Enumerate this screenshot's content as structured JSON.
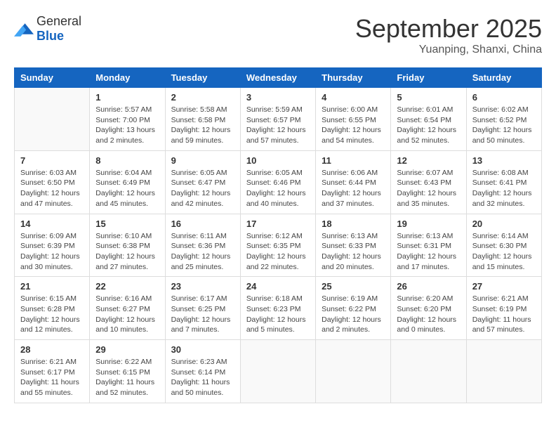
{
  "header": {
    "logo_general": "General",
    "logo_blue": "Blue",
    "month_title": "September 2025",
    "location": "Yuanping, Shanxi, China"
  },
  "weekdays": [
    "Sunday",
    "Monday",
    "Tuesday",
    "Wednesday",
    "Thursday",
    "Friday",
    "Saturday"
  ],
  "weeks": [
    [
      {
        "day": "",
        "sunrise": "",
        "sunset": "",
        "daylight": ""
      },
      {
        "day": "1",
        "sunrise": "Sunrise: 5:57 AM",
        "sunset": "Sunset: 7:00 PM",
        "daylight": "Daylight: 13 hours and 2 minutes."
      },
      {
        "day": "2",
        "sunrise": "Sunrise: 5:58 AM",
        "sunset": "Sunset: 6:58 PM",
        "daylight": "Daylight: 12 hours and 59 minutes."
      },
      {
        "day": "3",
        "sunrise": "Sunrise: 5:59 AM",
        "sunset": "Sunset: 6:57 PM",
        "daylight": "Daylight: 12 hours and 57 minutes."
      },
      {
        "day": "4",
        "sunrise": "Sunrise: 6:00 AM",
        "sunset": "Sunset: 6:55 PM",
        "daylight": "Daylight: 12 hours and 54 minutes."
      },
      {
        "day": "5",
        "sunrise": "Sunrise: 6:01 AM",
        "sunset": "Sunset: 6:54 PM",
        "daylight": "Daylight: 12 hours and 52 minutes."
      },
      {
        "day": "6",
        "sunrise": "Sunrise: 6:02 AM",
        "sunset": "Sunset: 6:52 PM",
        "daylight": "Daylight: 12 hours and 50 minutes."
      }
    ],
    [
      {
        "day": "7",
        "sunrise": "Sunrise: 6:03 AM",
        "sunset": "Sunset: 6:50 PM",
        "daylight": "Daylight: 12 hours and 47 minutes."
      },
      {
        "day": "8",
        "sunrise": "Sunrise: 6:04 AM",
        "sunset": "Sunset: 6:49 PM",
        "daylight": "Daylight: 12 hours and 45 minutes."
      },
      {
        "day": "9",
        "sunrise": "Sunrise: 6:05 AM",
        "sunset": "Sunset: 6:47 PM",
        "daylight": "Daylight: 12 hours and 42 minutes."
      },
      {
        "day": "10",
        "sunrise": "Sunrise: 6:05 AM",
        "sunset": "Sunset: 6:46 PM",
        "daylight": "Daylight: 12 hours and 40 minutes."
      },
      {
        "day": "11",
        "sunrise": "Sunrise: 6:06 AM",
        "sunset": "Sunset: 6:44 PM",
        "daylight": "Daylight: 12 hours and 37 minutes."
      },
      {
        "day": "12",
        "sunrise": "Sunrise: 6:07 AM",
        "sunset": "Sunset: 6:43 PM",
        "daylight": "Daylight: 12 hours and 35 minutes."
      },
      {
        "day": "13",
        "sunrise": "Sunrise: 6:08 AM",
        "sunset": "Sunset: 6:41 PM",
        "daylight": "Daylight: 12 hours and 32 minutes."
      }
    ],
    [
      {
        "day": "14",
        "sunrise": "Sunrise: 6:09 AM",
        "sunset": "Sunset: 6:39 PM",
        "daylight": "Daylight: 12 hours and 30 minutes."
      },
      {
        "day": "15",
        "sunrise": "Sunrise: 6:10 AM",
        "sunset": "Sunset: 6:38 PM",
        "daylight": "Daylight: 12 hours and 27 minutes."
      },
      {
        "day": "16",
        "sunrise": "Sunrise: 6:11 AM",
        "sunset": "Sunset: 6:36 PM",
        "daylight": "Daylight: 12 hours and 25 minutes."
      },
      {
        "day": "17",
        "sunrise": "Sunrise: 6:12 AM",
        "sunset": "Sunset: 6:35 PM",
        "daylight": "Daylight: 12 hours and 22 minutes."
      },
      {
        "day": "18",
        "sunrise": "Sunrise: 6:13 AM",
        "sunset": "Sunset: 6:33 PM",
        "daylight": "Daylight: 12 hours and 20 minutes."
      },
      {
        "day": "19",
        "sunrise": "Sunrise: 6:13 AM",
        "sunset": "Sunset: 6:31 PM",
        "daylight": "Daylight: 12 hours and 17 minutes."
      },
      {
        "day": "20",
        "sunrise": "Sunrise: 6:14 AM",
        "sunset": "Sunset: 6:30 PM",
        "daylight": "Daylight: 12 hours and 15 minutes."
      }
    ],
    [
      {
        "day": "21",
        "sunrise": "Sunrise: 6:15 AM",
        "sunset": "Sunset: 6:28 PM",
        "daylight": "Daylight: 12 hours and 12 minutes."
      },
      {
        "day": "22",
        "sunrise": "Sunrise: 6:16 AM",
        "sunset": "Sunset: 6:27 PM",
        "daylight": "Daylight: 12 hours and 10 minutes."
      },
      {
        "day": "23",
        "sunrise": "Sunrise: 6:17 AM",
        "sunset": "Sunset: 6:25 PM",
        "daylight": "Daylight: 12 hours and 7 minutes."
      },
      {
        "day": "24",
        "sunrise": "Sunrise: 6:18 AM",
        "sunset": "Sunset: 6:23 PM",
        "daylight": "Daylight: 12 hours and 5 minutes."
      },
      {
        "day": "25",
        "sunrise": "Sunrise: 6:19 AM",
        "sunset": "Sunset: 6:22 PM",
        "daylight": "Daylight: 12 hours and 2 minutes."
      },
      {
        "day": "26",
        "sunrise": "Sunrise: 6:20 AM",
        "sunset": "Sunset: 6:20 PM",
        "daylight": "Daylight: 12 hours and 0 minutes."
      },
      {
        "day": "27",
        "sunrise": "Sunrise: 6:21 AM",
        "sunset": "Sunset: 6:19 PM",
        "daylight": "Daylight: 11 hours and 57 minutes."
      }
    ],
    [
      {
        "day": "28",
        "sunrise": "Sunrise: 6:21 AM",
        "sunset": "Sunset: 6:17 PM",
        "daylight": "Daylight: 11 hours and 55 minutes."
      },
      {
        "day": "29",
        "sunrise": "Sunrise: 6:22 AM",
        "sunset": "Sunset: 6:15 PM",
        "daylight": "Daylight: 11 hours and 52 minutes."
      },
      {
        "day": "30",
        "sunrise": "Sunrise: 6:23 AM",
        "sunset": "Sunset: 6:14 PM",
        "daylight": "Daylight: 11 hours and 50 minutes."
      },
      {
        "day": "",
        "sunrise": "",
        "sunset": "",
        "daylight": ""
      },
      {
        "day": "",
        "sunrise": "",
        "sunset": "",
        "daylight": ""
      },
      {
        "day": "",
        "sunrise": "",
        "sunset": "",
        "daylight": ""
      },
      {
        "day": "",
        "sunrise": "",
        "sunset": "",
        "daylight": ""
      }
    ]
  ]
}
